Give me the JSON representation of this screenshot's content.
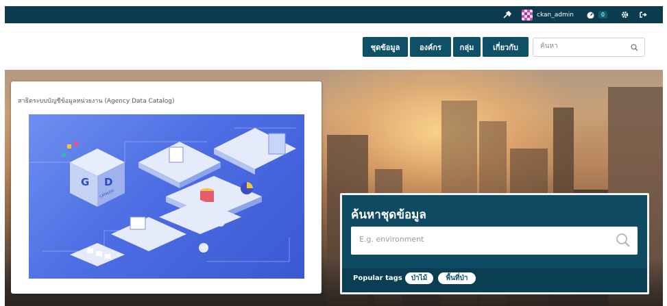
{
  "topbar": {
    "username": "ckan_admin",
    "dashboard_count": "0",
    "colors": {
      "bar": "#0c3a4f",
      "badge": "#0d5f74"
    }
  },
  "nav": {
    "items": [
      {
        "label": "ชุดข้อมูล"
      },
      {
        "label": "องค์กร"
      },
      {
        "label": "กลุ่ม"
      },
      {
        "label": "เกี่ยวกับ"
      }
    ],
    "search_placeholder": "ค้นหา",
    "colors": {
      "button": "#0d5068"
    }
  },
  "hero": {
    "card_title": "สาธิตระบบบัญชีข้อมูลหน่วยงาน (Agency Data Catalog)",
    "illustration": {
      "badge_letters": [
        "G",
        "D"
      ],
      "badge_caption": "CATALOG"
    }
  },
  "search_panel": {
    "title": "ค้นหาชุดข้อมูล",
    "placeholder": "E.g. environment",
    "popular_tags_label": "Popular tags",
    "tags": [
      {
        "label": "ป่าไม้"
      },
      {
        "label": "พื้นที่ป่า"
      }
    ],
    "colors": {
      "panel": "#0e4a62",
      "tags_bar": "#0a3e53"
    }
  }
}
